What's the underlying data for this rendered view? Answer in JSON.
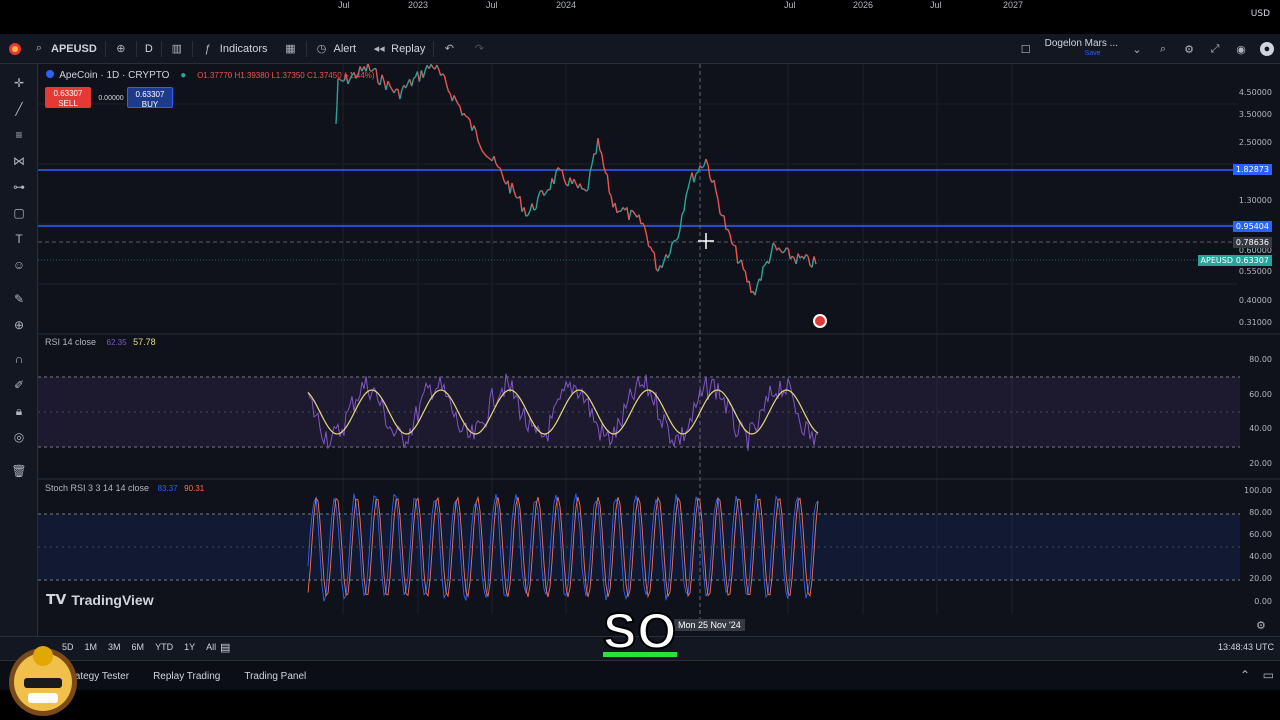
{
  "header": {
    "symbol": "APEUSD",
    "interval": "D",
    "indicators_label": "Indicators",
    "alert_label": "Alert",
    "replay_label": "Replay",
    "account_name": "Dogelon Mars ...",
    "account_sub": "Save"
  },
  "chart": {
    "title": "ApeCoin · 1D · CRYPTO",
    "ohlc": "O1.37770 H1.39380 L1.37350 C1.37450 (-1.44%)",
    "sell_price": "0.63307",
    "sell_label": "SELL",
    "spread": "0.00000",
    "buy_price": "0.63307",
    "buy_label": "BUY",
    "currency": "USD",
    "price_axis": [
      "4.50000",
      "3.50000",
      "2.50000",
      "1.30000",
      "0.60000",
      "0.55000",
      "0.40000",
      "0.31000"
    ],
    "tag_upper_line": "1.82873",
    "tag_lower_line": "0.95404",
    "tag_crosshair": "0.78636",
    "tag_symbol": "APEUSD",
    "tag_last": "0.63307",
    "crosshair_date": "Mon 25 Nov '24",
    "time_axis": [
      "Jul",
      "2023",
      "Jul",
      "2024",
      "Jul",
      "2026",
      "Jul",
      "2027"
    ],
    "clock": "13:48:43 UTC"
  },
  "rsi": {
    "label": "RSI 14 close",
    "value1": "62.35",
    "value2": "57.78",
    "axis": [
      "80.00",
      "60.00",
      "40.00",
      "20.00"
    ],
    "color_line": "#7e57c2",
    "color_ma": "#e6d87a"
  },
  "stoch": {
    "label": "Stoch RSI 3 3 14 14 close",
    "value1": "83.37",
    "value2": "90.31",
    "axis": [
      "100.00",
      "80.00",
      "60.00",
      "40.00",
      "20.00",
      "0.00"
    ],
    "color_k": "#2962ff",
    "color_d": "#ff7043"
  },
  "branding": {
    "logo_text": "TradingView"
  },
  "timeframes": [
    "5D",
    "1M",
    "3M",
    "6M",
    "YTD",
    "1Y",
    "All"
  ],
  "panels": [
    "Strategy Tester",
    "Replay Trading",
    "Trading Panel"
  ],
  "caption": "SO",
  "colors": {
    "level_line": "#2962ff",
    "up": "#26a69a",
    "down": "#ef5350",
    "bg": "#0f121b"
  }
}
